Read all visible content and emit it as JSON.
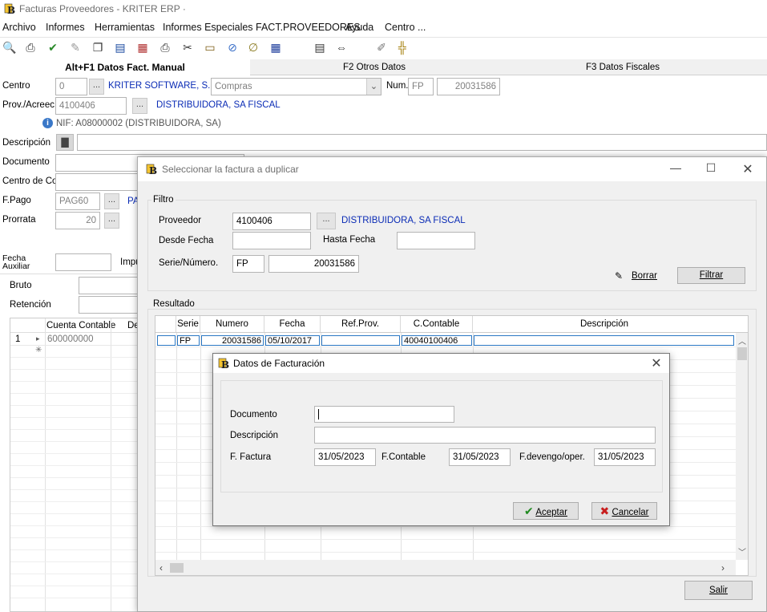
{
  "window": {
    "title": "Facturas Proveedores  - KRITER ERP ·"
  },
  "menu": [
    "Archivo",
    "Informes",
    "Herramientas",
    "Informes Especiales FACT.PROVEEDORES",
    "Ayuda",
    "Centro ..."
  ],
  "tabs": [
    "Alt+F1 Datos Fact. Manual",
    "F2 Otros Datos",
    "F3 Datos Fiscales"
  ],
  "form": {
    "centro_label": "Centro",
    "centro_value": "0",
    "centro_name": "KRITER SOFTWARE, S.I",
    "compras_value": "Compras",
    "num_label": "Num.",
    "num_serie": "FP",
    "num_value": "20031586",
    "prov_label": "Prov./Acreec",
    "prov_value": "4100406",
    "prov_name": "DISTRIBUIDORA, SA FISCAL",
    "nif_text": "NIF:  A08000002 (DISTRIBUIDORA, SA)",
    "descripcion_label": "Descripción",
    "documento_label": "Documento",
    "centro_co_label": "Centro de Co",
    "fpago_label": "F.Pago",
    "fpago_value": "PAG60",
    "fpago_link": "PA",
    "prorrata_label": "Prorrata",
    "prorrata_value": "20",
    "fecha_aux_label1": "Fecha",
    "fecha_aux_label2": "Auxiliar",
    "impu_label": "Impu",
    "bruto_label": "Bruto",
    "retencion_label": "Retención",
    "grid_col_cuenta": "Cuenta Contable",
    "grid_col_de": "De",
    "grid_row_num": "1",
    "grid_row_cuenta": "600000000"
  },
  "dialog1": {
    "title": "Seleccionar la factura a duplicar",
    "filtro_label": "Filtro",
    "proveedor_label": "Proveedor",
    "proveedor_value": "4100406",
    "proveedor_name": "DISTRIBUIDORA, SA FISCAL",
    "desde_label": "Desde Fecha",
    "hasta_label": "Hasta Fecha",
    "serie_label": "Serie/Número.",
    "serie_value": "FP",
    "numero_value": "20031586",
    "borrar": "Borrar",
    "filtrar": "Filtrar",
    "resultado_label": "Resultado",
    "columns": [
      "Serie",
      "Numero",
      "Fecha",
      "Ref.Prov.",
      "C.Contable",
      "Descripción"
    ],
    "row": {
      "serie": "FP",
      "numero": "20031586",
      "fecha": "05/10/2017",
      "ref": "",
      "contable": "40040100406",
      "descripcion": ""
    },
    "salir": "Salir"
  },
  "dialog2": {
    "title": "Datos de Facturación",
    "documento_label": "Documento",
    "descripcion_label": "Descripción",
    "ffactura_label": "F. Factura",
    "ffactura_value": "31/05/2023",
    "fcontable_label": "F.Contable",
    "fcontable_value": "31/05/2023",
    "fdevengo_label": "F.devengo/oper.",
    "fdevengo_value": "31/05/2023",
    "aceptar": "Aceptar",
    "cancelar": "Cancelar"
  }
}
